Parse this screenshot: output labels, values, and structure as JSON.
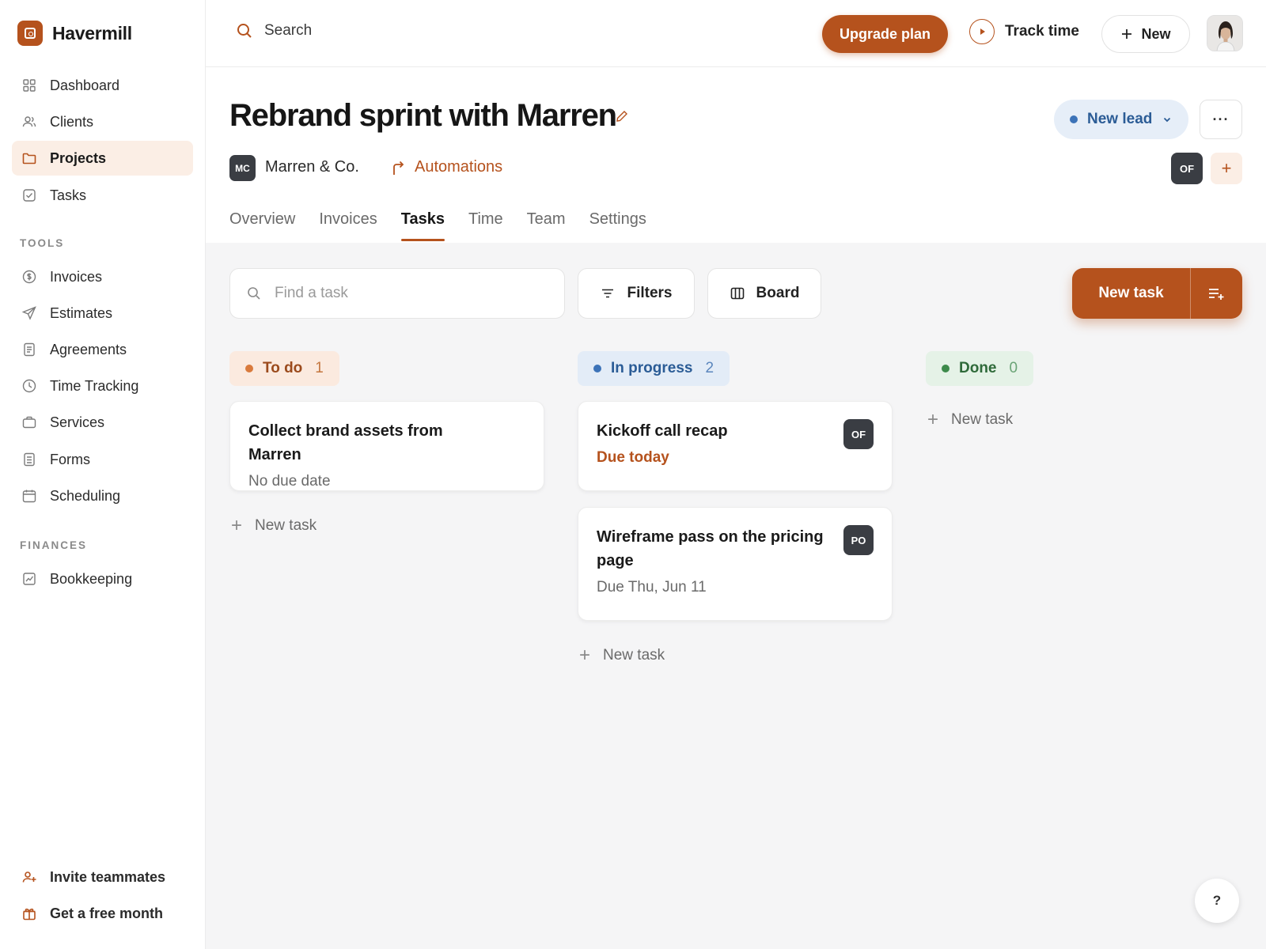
{
  "app": {
    "name": "Havermill"
  },
  "sidebar": {
    "main": [
      {
        "label": "Dashboard",
        "icon": "grid-icon"
      },
      {
        "label": "Clients",
        "icon": "users-icon"
      },
      {
        "label": "Projects",
        "icon": "folder-icon",
        "active": true
      },
      {
        "label": "Tasks",
        "icon": "check-square-icon"
      }
    ],
    "tools_label": "TOOLS",
    "tools": [
      {
        "label": "Invoices",
        "icon": "dollar-circle-icon"
      },
      {
        "label": "Estimates",
        "icon": "send-icon"
      },
      {
        "label": "Agreements",
        "icon": "document-icon"
      },
      {
        "label": "Time Tracking",
        "icon": "clock-icon"
      },
      {
        "label": "Services",
        "icon": "briefcase-icon"
      },
      {
        "label": "Forms",
        "icon": "form-icon"
      },
      {
        "label": "Scheduling",
        "icon": "calendar-icon"
      }
    ],
    "finances_label": "FINANCES",
    "finances": [
      {
        "label": "Bookkeeping",
        "icon": "chart-icon"
      }
    ],
    "footer": [
      {
        "label": "Invite teammates",
        "icon": "user-plus-icon"
      },
      {
        "label": "Get a free month",
        "icon": "gift-icon"
      }
    ]
  },
  "topbar": {
    "search_label": "Search",
    "upgrade_label": "Upgrade plan",
    "track_label": "Track time",
    "new_label": "New"
  },
  "project": {
    "title": "Rebrand sprint with Marren",
    "status": "New lead",
    "client_initials": "MC",
    "client_name": "Marren & Co.",
    "automations_label": "Automations",
    "member_initials": "OF",
    "add_member": "+",
    "more": "···"
  },
  "tabs": [
    {
      "label": "Overview"
    },
    {
      "label": "Invoices"
    },
    {
      "label": "Tasks",
      "active": true
    },
    {
      "label": "Time"
    },
    {
      "label": "Team"
    },
    {
      "label": "Settings"
    }
  ],
  "toolbar": {
    "find_placeholder": "Find a task",
    "filters_label": "Filters",
    "board_label": "Board",
    "new_task_label": "New task"
  },
  "columns": {
    "todo": {
      "label": "To do",
      "count": "1",
      "color": "#d97a3c"
    },
    "progress": {
      "label": "In progress",
      "count": "2",
      "color": "#3c73b8"
    },
    "done": {
      "label": "Done",
      "count": "0",
      "color": "#3d8a4b"
    }
  },
  "cards": {
    "todo": [
      {
        "title": "Collect brand assets from Marren",
        "due": "No due date"
      }
    ],
    "progress": [
      {
        "title": "Kickoff call recap",
        "due": "Due today",
        "assignee": "OF"
      },
      {
        "title": "Wireframe pass on the pricing page",
        "due": "Due Thu, Jun 11",
        "assignee": "PO"
      }
    ]
  },
  "add_task_label": "New task",
  "help_label": "?",
  "colors": {
    "accent": "#b5521d",
    "accent_soft": "#fbeee5"
  }
}
